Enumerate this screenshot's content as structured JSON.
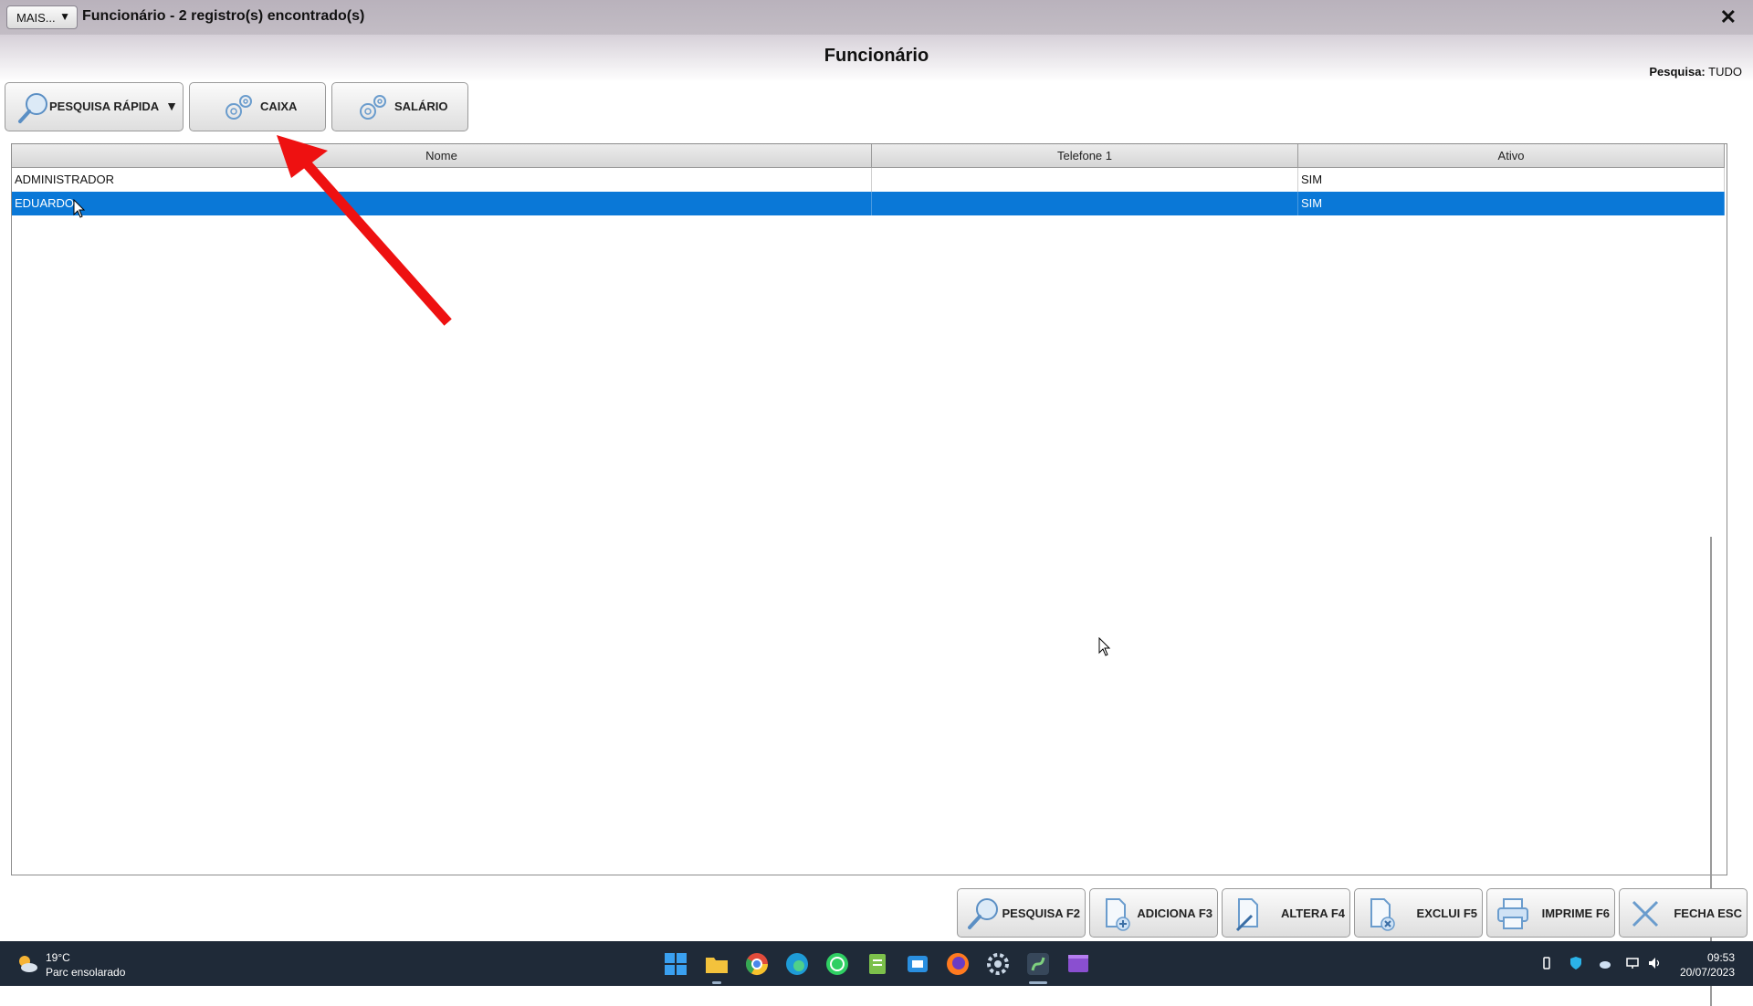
{
  "titlebar": {
    "more_label": "MAIS...",
    "more_arrow": "▼",
    "title": "Funcionário - 2 registro(s) encontrado(s)",
    "close_glyph": "✕"
  },
  "page": {
    "title": "Funcionário",
    "search_scope_label": "Pesquisa:",
    "search_scope_value": "TUDO"
  },
  "toolbar": {
    "quick_search_label": "PESQUISA RÁPIDA",
    "quick_search_arrow": "▼",
    "cash_label": "CAIXA",
    "salary_label": "SALÁRIO"
  },
  "grid": {
    "columns": [
      "Nome",
      "Telefone 1",
      "Ativo"
    ],
    "rows": [
      {
        "nome": "ADMINISTRADOR",
        "telefone": "",
        "ativo": "SIM",
        "selected": false
      },
      {
        "nome": "EDUARDO",
        "telefone": "",
        "ativo": "SIM",
        "selected": true
      }
    ]
  },
  "bottom_buttons": {
    "search": "PESQUISA F2",
    "add": "ADICIONA F3",
    "edit": "ALTERA F4",
    "delete": "EXCLUI F5",
    "print": "IMPRIME F6",
    "close": "FECHA ESC"
  },
  "taskbar": {
    "weather_temp": "19°C",
    "weather_desc": "Parc ensolarado",
    "time": "09:53",
    "date": "20/07/2023",
    "apps": [
      "windows-start",
      "file-explorer",
      "chrome",
      "edge",
      "whatsapp",
      "notepad",
      "remote-app",
      "firefox",
      "settings",
      "system-app",
      "media-app"
    ]
  },
  "colors": {
    "selection": "#0a78d7",
    "annotation_arrow": "#ee1111",
    "taskbar": "#1f2a38"
  }
}
